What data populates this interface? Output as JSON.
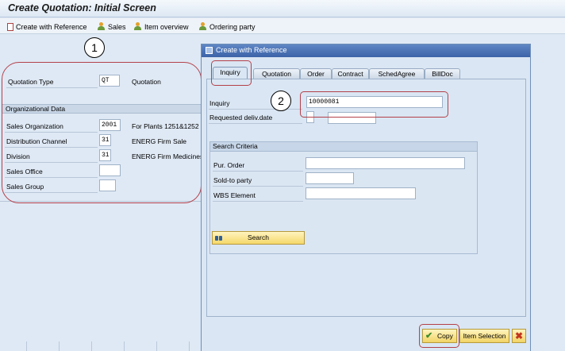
{
  "window": {
    "title": "Create Quotation: Initial Screen"
  },
  "toolbar": {
    "items": [
      {
        "label": "Create with Reference",
        "icon": "document-icon"
      },
      {
        "label": "Sales",
        "icon": "person-icon"
      },
      {
        "label": "Item overview",
        "icon": "person-icon"
      },
      {
        "label": "Ordering party",
        "icon": "person-icon"
      }
    ]
  },
  "annotations": {
    "one": "1",
    "two": "2"
  },
  "main": {
    "quotation_type": {
      "label": "Quotation Type",
      "value": "QT",
      "desc": "Quotation"
    },
    "org_section_title": "Organizational Data",
    "fields": [
      {
        "label": "Sales Organization",
        "value": "2001",
        "desc": "For Plants 1251&1252"
      },
      {
        "label": "Distribution Channel",
        "value": "31",
        "desc": "ENERG Firm Sale"
      },
      {
        "label": "Division",
        "value": "31",
        "desc": "ENERG Firm Medicines"
      },
      {
        "label": "Sales Office",
        "value": "",
        "desc": ""
      },
      {
        "label": "Sales Group",
        "value": "",
        "desc": ""
      }
    ]
  },
  "dialog": {
    "title": "Create with Reference",
    "tabs": [
      "Inquiry",
      "Quotation",
      "Order",
      "Contract",
      "SchedAgree",
      "BillDoc"
    ],
    "active_tab": "Inquiry",
    "inquiry": {
      "label": "Inquiry",
      "value": "10000081"
    },
    "requested_delivery_date": {
      "label": "Requested deliv.date",
      "value": ""
    },
    "search_criteria": {
      "title": "Search Criteria",
      "fields": [
        {
          "label": "Pur. Order",
          "value": ""
        },
        {
          "label": "Sold-to party",
          "value": ""
        },
        {
          "label": "WBS Element",
          "value": ""
        }
      ],
      "search_label": "Search"
    },
    "footer": {
      "copy_label": "Copy",
      "item_selection_label": "Item Selection",
      "close_symbol": "✖"
    }
  },
  "colors": {
    "annotation": "#b4414a",
    "dialog_title": "#3b63a8",
    "button_yellow": "#f5d76a",
    "background": "#dfe9f5"
  }
}
